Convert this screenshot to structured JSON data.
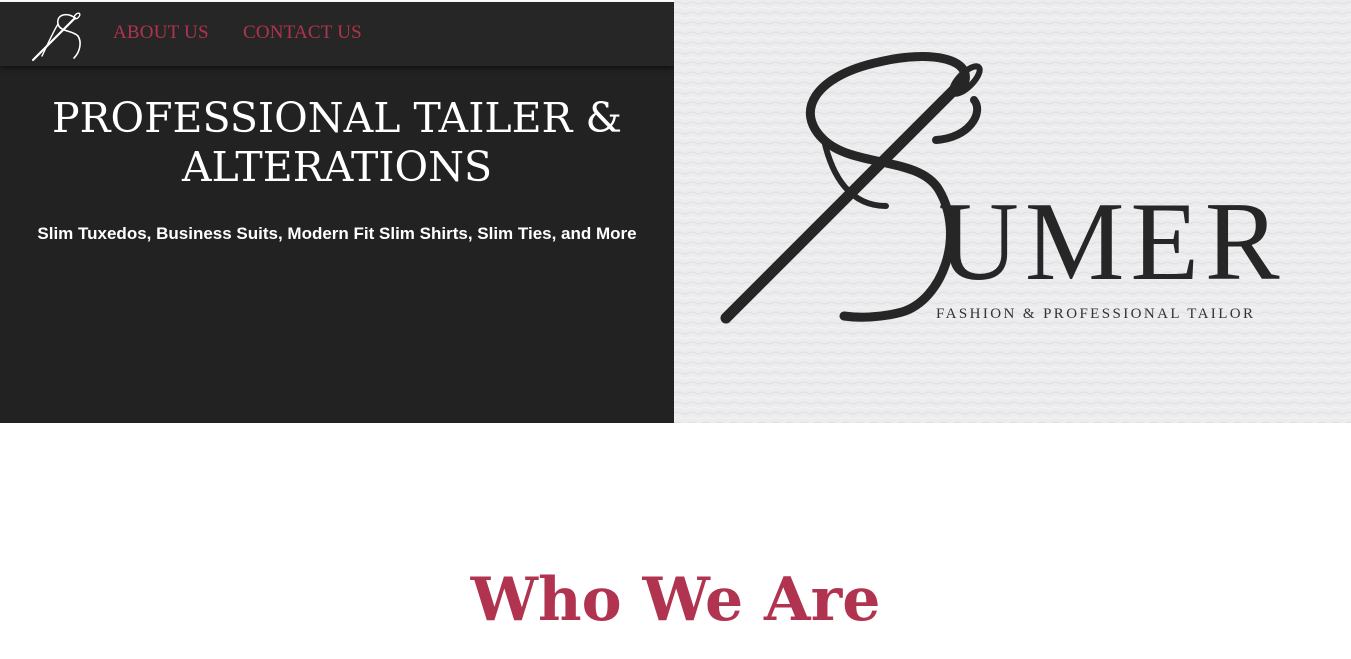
{
  "nav": {
    "logo_icon": "needle-thread-logo-icon",
    "links": [
      {
        "label": "ABOUT US"
      },
      {
        "label": "CONTACT US"
      }
    ],
    "link_color": "#b0344f"
  },
  "hero": {
    "title": "PROFESSIONAL TAILER & ALTERATIONS",
    "subtitle": "Slim Tuxedos, Business Suits, Modern Fit Slim Shirts, Slim Ties, and More",
    "background_color": "#222222"
  },
  "brand": {
    "name": "UMER",
    "tagline": "FASHION & PROFESSIONAL TAILOR",
    "logo_icon": "needle-thread-brand-icon"
  },
  "about": {
    "heading": "Who We Are",
    "heading_color": "#b0344f"
  }
}
